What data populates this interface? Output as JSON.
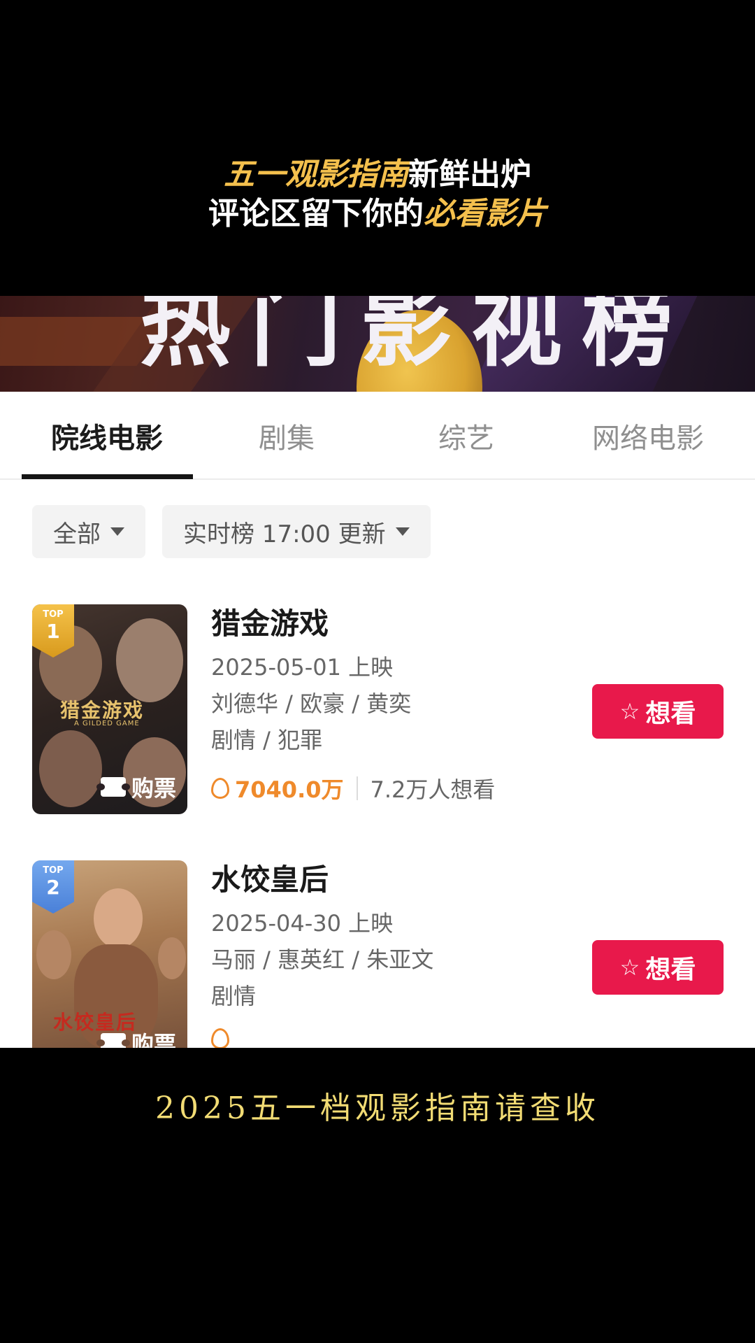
{
  "caption_top": {
    "line1_highlight": "五一观影指南",
    "line1_rest": "新鲜出炉",
    "line2_rest": "评论区留下你的",
    "line2_highlight": "必看影片"
  },
  "banner": {
    "text": "热门影视榜"
  },
  "tabs": [
    {
      "label": "院线电影",
      "active": true
    },
    {
      "label": "剧集",
      "active": false
    },
    {
      "label": "综艺",
      "active": false
    },
    {
      "label": "网络电影",
      "active": false
    }
  ],
  "filters": {
    "scope": "全部",
    "ranking": "实时榜 17:00 更新"
  },
  "movies": [
    {
      "rank_label": "TOP",
      "rank": "1",
      "poster_title": "猎金游戏",
      "poster_subtitle": "A GILDED GAME",
      "buy_label": "购票",
      "title": "猎金游戏",
      "release": "2025-05-01 上映",
      "cast": "刘德华 / 欧豪 / 黄奕",
      "genre": "剧情 / 犯罪",
      "heat": "7040.0万",
      "want_count": "7.2万人想看",
      "want_label": "想看"
    },
    {
      "rank_label": "TOP",
      "rank": "2",
      "poster_title": "水饺皇后",
      "buy_label": "购票",
      "title": "水饺皇后",
      "release": "2025-04-30 上映",
      "cast": "马丽 / 惠英红 / 朱亚文",
      "genre": "剧情",
      "want_label": "想看"
    }
  ],
  "caption_bottom": "2025五一档观影指南请查收",
  "colors": {
    "accent_red": "#e8194b",
    "heat_orange": "#ef8a2b",
    "caption_gold": "#f4c04d",
    "caption_bottom": "#f2dc74"
  },
  "icons": [
    "ticket-icon",
    "star-icon",
    "flame-icon",
    "chevron-down-icon"
  ]
}
